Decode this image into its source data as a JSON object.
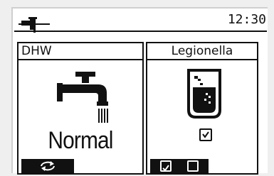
{
  "header": {
    "time": "12:30",
    "icon": "water-tap-icon"
  },
  "panels": [
    {
      "title": "DHW",
      "icon": "faucet-icon",
      "mode": "Normal",
      "button_icon": "cycle-icon"
    },
    {
      "title": "Legionella",
      "icon": "water-tank-icon",
      "checked": true,
      "toggle_icons": [
        "checkbox-checked-icon",
        "checkbox-empty-icon"
      ]
    }
  ]
}
